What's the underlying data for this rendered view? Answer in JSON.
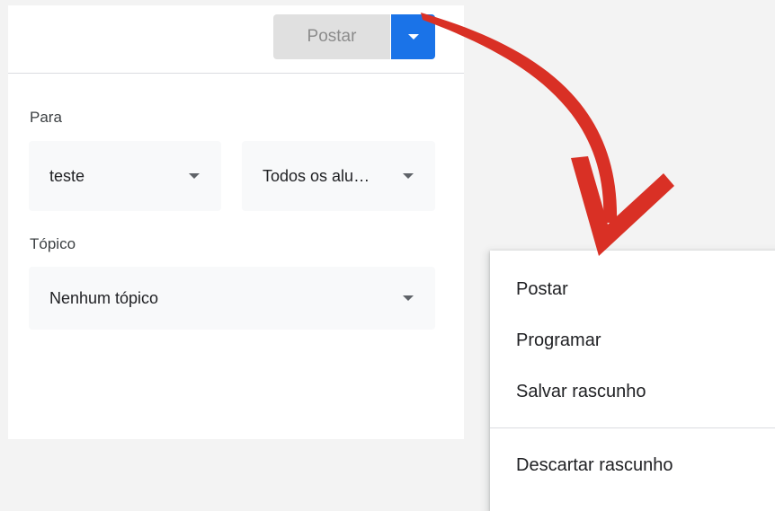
{
  "header": {
    "post_label": "Postar",
    "dropdown_icon": "caret-down-icon",
    "accent_color": "#1a73e8"
  },
  "form": {
    "para_label": "Para",
    "class_select": {
      "value": "teste"
    },
    "students_select": {
      "value": "Todos os alu…"
    },
    "topic_label": "Tópico",
    "topic_select": {
      "value": "Nenhum tópico"
    }
  },
  "menu": {
    "items": [
      {
        "label": "Postar"
      },
      {
        "label": "Programar"
      },
      {
        "label": "Salvar rascunho"
      },
      {
        "label": "Descartar rascunho"
      }
    ]
  },
  "annotation": {
    "arrow_color": "#d93025"
  }
}
